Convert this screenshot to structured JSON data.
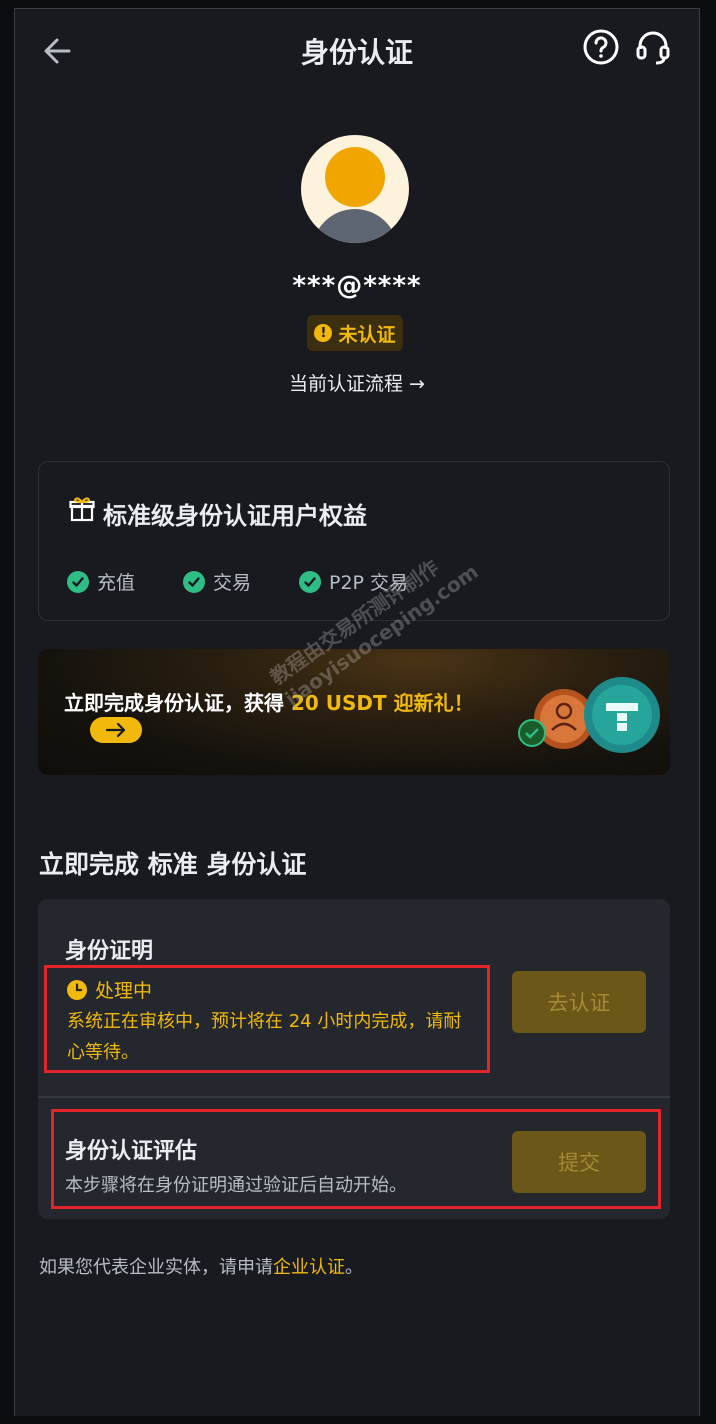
{
  "header": {
    "title": "身份认证",
    "back_icon": "arrow-left-icon",
    "help_icon": "question-circle-icon",
    "support_icon": "headset-icon"
  },
  "profile": {
    "email": "***@****",
    "status": "未认证",
    "flow_link": "当前认证流程 →"
  },
  "benefits": {
    "title": "标准级身份认证用户权益",
    "items": [
      {
        "label": "充值"
      },
      {
        "label": "交易"
      },
      {
        "label": "P2P 交易"
      }
    ]
  },
  "promo": {
    "text_prefix": "立即完成身份认证，获得 ",
    "text_highlight": "20 USDT 迎新礼",
    "text_suffix": "！"
  },
  "watermark": {
    "line1": "教程由交易所测评制作",
    "line2": "jiaoyisuoceping.com"
  },
  "section": {
    "title": "立即完成 标准 身份认证"
  },
  "steps": {
    "identity": {
      "title": "身份证明",
      "status": "处理中",
      "message": "系统正在审核中，预计将在 24 小时内完成，请耐心等待。",
      "button": "去认证"
    },
    "assessment": {
      "title": "身份认证评估",
      "description": "本步骤将在身份证明通过验证后自动开始。",
      "button": "提交"
    }
  },
  "footer": {
    "prefix": "如果您代表企业实体，请申请",
    "link": "企业认证",
    "suffix": "。"
  },
  "colors": {
    "accent": "#f0b90b",
    "success": "#2ebd85",
    "highlight_border": "#e3242b",
    "background": "#181a20"
  }
}
